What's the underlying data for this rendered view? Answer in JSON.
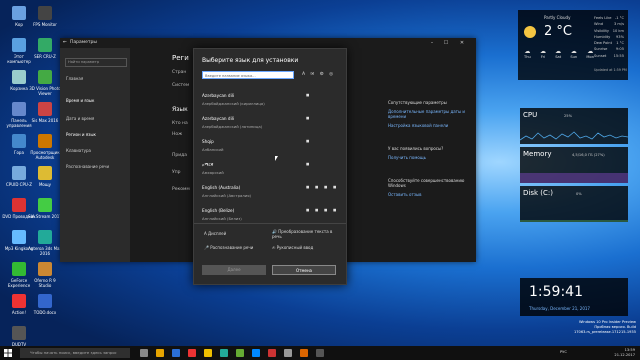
{
  "desktop": {
    "icons": [
      {
        "label": "Кор",
        "color": "#6aa0e0"
      },
      {
        "label": "FPS Monitor",
        "color": "#444"
      },
      {
        "label": "Этот компьютер",
        "color": "#5aa0e0"
      },
      {
        "label": "SER CRU-Z",
        "color": "#3a6"
      },
      {
        "label": "Корзина",
        "color": "#9cc"
      },
      {
        "label": "3D Vision Photo Viewer",
        "color": "#4a4"
      },
      {
        "label": "Панель управления",
        "color": "#68c"
      },
      {
        "label": "Sis Max 2016",
        "color": "#c44"
      },
      {
        "label": "Гора",
        "color": "#48c"
      },
      {
        "label": "Просмотрщик Autodesk",
        "color": "#c70"
      },
      {
        "label": "CPUID CPU-Z",
        "color": "#7ad"
      },
      {
        "label": "Мощу",
        "color": "#db3"
      },
      {
        "label": "DVD Проводник",
        "color": "#d33"
      },
      {
        "label": "SIA Stream 2017",
        "color": "#4c4"
      },
      {
        "label": "Mp3 Kingkong",
        "color": "#6bf"
      },
      {
        "label": "Anteroa 3ds Max 2016",
        "color": "#2a9"
      },
      {
        "label": "GeForce Experience",
        "color": "#3b3"
      },
      {
        "label": "Oferno R 9 Studio",
        "color": "#c83"
      },
      {
        "label": "Action!",
        "color": "#e33"
      },
      {
        "label": "TODO.docx",
        "color": "#36c"
      },
      {
        "label": "DUDTV",
        "color": "#555"
      }
    ]
  },
  "settings": {
    "title": "Параметры",
    "nav_search": "Найти параметр",
    "nav_items": [
      "Главная",
      "Время и язык",
      "Дата и время",
      "Регион и язык",
      "Клавиатура",
      "Распознавание речи"
    ],
    "main_heading": "Реги",
    "main_lines": [
      "Стран",
      "Систем",
      "Язык",
      "Кто на",
      "Нож",
      "Прида",
      "Упр",
      "Рекомм"
    ],
    "right_blocks": [
      {
        "title": "Сопутствующие параметры",
        "link": "Дополнительные параметры даты и времени",
        "link2": "Настройка языковой панели"
      },
      {
        "title": "У вас появились вопросы?",
        "link": "Получить помощь"
      },
      {
        "title": "Способствуйте совершенствованию Windows",
        "link": "Оставить отзыв"
      }
    ]
  },
  "dialog": {
    "title": "Выберите язык для установки",
    "search_placeholder": "Введите название языка...",
    "filter_icons": "A ✉ ⚙ ◎",
    "languages": [
      {
        "name": "Azərbaycan dili",
        "sub": "Азербайджанский (кириллица)"
      },
      {
        "name": "Azərbaycan dili",
        "sub": "Азербайджанский (латиница)"
      },
      {
        "name": "Shqip",
        "sub": "Албанский"
      },
      {
        "name": "አማርኛ",
        "sub": "Амхарский"
      },
      {
        "name": "English (Australia)",
        "sub": "Английский (Австралия)"
      },
      {
        "name": "English (Belize)",
        "sub": "Английский (Белиз)"
      }
    ],
    "options": [
      {
        "label": "Дисплей",
        "icon": "A"
      },
      {
        "label": "Преобразование текста в речь",
        "icon": "🔊"
      },
      {
        "label": "Распознавание речи",
        "icon": "🎤"
      },
      {
        "label": "Рукописный ввод",
        "icon": "✍"
      }
    ],
    "btn_next": "Далее",
    "btn_cancel": "Отмена"
  },
  "weather": {
    "condition": "Partly Cloudy",
    "temp": "2 °C",
    "details": [
      "Feels Like",
      "Wind",
      "Visibility",
      "Humidity",
      "Dew Point",
      "",
      "Sunrise",
      "Sunset"
    ],
    "values": [
      "-1 °C",
      "3 m/s",
      "10 km",
      "93%",
      "1 °C",
      "",
      "9:05",
      "15:55"
    ],
    "days": [
      "Thu",
      "Fri",
      "Sat",
      "Sun",
      "Mon"
    ],
    "updated": "Updated at 1:59 PM"
  },
  "monitors": {
    "cpu": {
      "label": "CPU",
      "value": "25%"
    },
    "memory": {
      "label": "Memory",
      "value": "4,5/16,0 ГБ (27%)"
    },
    "disk": {
      "label": "Disk (C:)",
      "value": "0%"
    }
  },
  "clock": {
    "time": "1:59:41",
    "date": "Thursday, December 21, 2017"
  },
  "watermark": [
    "Windows 10 Pro Insider Preview",
    "Пробная версия. Build 17063.rs_prerelease.171215-1935"
  ],
  "taskbar": {
    "search_placeholder": "Чтобы начать поиск, введите здесь запрос",
    "tray_time": "13:59",
    "tray_date": "21.12.2017",
    "lang": "РУС"
  },
  "colors": {
    "accent": "#0078d7",
    "link": "#7ab8ff",
    "cpu_line": "#4fa8e8"
  }
}
